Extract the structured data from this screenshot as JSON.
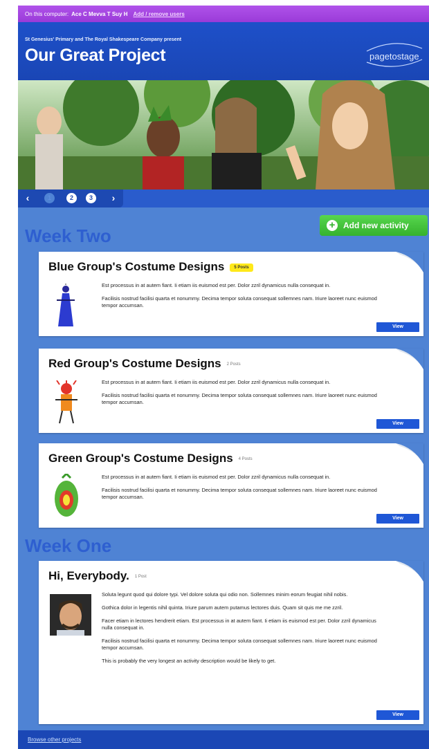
{
  "topbar": {
    "prefix": "On this computer:",
    "names": "Ace C  Mevva T  Suy H",
    "add_remove": "Add / remove users"
  },
  "header": {
    "subtitle": "St Genesius' Primary and The Royal Shakespeare Company present",
    "title": "Our Great Project",
    "logo": "pagetostage"
  },
  "pager": {
    "prev": "‹",
    "next": "›",
    "pages": [
      "1",
      "2",
      "3"
    ],
    "active_page": 1
  },
  "add_activity": {
    "label": "Add new activity"
  },
  "weeks": [
    {
      "title": "Week Two",
      "activities": [
        {
          "title": "Blue Group's Costume Designs",
          "posts": "5 Posts",
          "highlight": true,
          "desc": [
            "Est processus in at autem fiant. Ii etiam iis euismod est per. Dolor zzril dynamicus nulla consequat in.",
            "Facilisis nostrud facilisi quarta et nonummy. Decima tempor soluta consequat sollemnes nam. Iriure laoreet nunc euismod tempor accumsan."
          ],
          "view": "View"
        },
        {
          "title": "Red Group's Costume Designs",
          "posts": "2 Posts",
          "highlight": false,
          "desc": [
            "Est processus in at autem fiant. Ii etiam iis euismod est per. Dolor zzril dynamicus nulla consequat in.",
            "Facilisis nostrud facilisi quarta et nonummy. Decima tempor soluta consequat sollemnes nam. Iriure laoreet nunc euismod tempor accumsan."
          ],
          "view": "View"
        },
        {
          "title": "Green Group's Costume Designs",
          "posts": "4 Posts",
          "highlight": false,
          "desc": [
            "Est processus in at autem fiant. Ii etiam iis euismod est per. Dolor zzril dynamicus nulla consequat in.",
            "Facilisis nostrud facilisi quarta et nonummy. Decima tempor soluta consequat sollemnes nam. Iriure laoreet nunc euismod tempor accumsan."
          ],
          "view": "View"
        }
      ]
    },
    {
      "title": "Week One",
      "activities": [
        {
          "title": "Hi, Everybody.",
          "posts": "1 Post",
          "highlight": false,
          "desc": [
            "Soluta legunt quod qui dolore typi. Vel dolore soluta qui odio non. Sollemnes minim eorum feugiat nihil nobis.",
            "Gothica dolor in legentis nihil quinta. Iriure parum autem putamus lectores duis. Quam sit quis me me zzril.",
            "Facer etiam in lectores hendrerit etiam. Est processus in at autem fiant. Ii etiam iis euismod est per. Dolor zzril dynamicus nulla consequat in.",
            "Facilisis nostrud facilisi quarta et nonummy. Decima tempor soluta consequat sollemnes nam. Iriure laoreet nunc euismod tempor accumsan.",
            "This is probably the very longest an activity description would be likely to get."
          ],
          "view": "View"
        }
      ]
    }
  ],
  "footer": {
    "browse": "Browse other projects"
  },
  "colors": {
    "topbar": "#a447e0",
    "header": "#1e50c9",
    "body": "#4f83d4",
    "week_title": "#2e5fd0",
    "add_button": "#3fbf36",
    "view_button": "#1f57d6",
    "badge": "#ffe91a"
  }
}
